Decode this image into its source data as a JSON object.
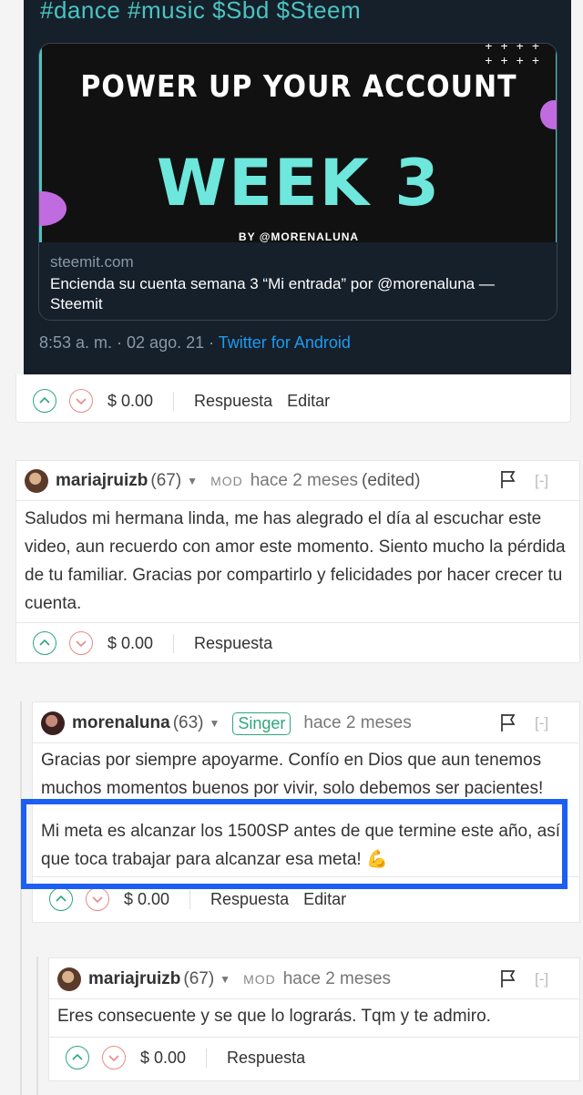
{
  "tweet": {
    "tags": "#dance #music $Sbd $Steem",
    "card_headline": "POWER UP YOUR ACCOUNT",
    "card_week": "WEEK 3",
    "card_by": "BY @MORENALUNA",
    "card_domain": "steemit.com",
    "card_title": "Encienda su cuenta semana 3 “Mi entrada” por @morenaluna — Steemit",
    "meta_time": "8:53 a. m. · 02 ago. 21 · ",
    "meta_source": "Twitter for Android"
  },
  "post_actions": {
    "amount": "$ 0.00",
    "reply": "Respuesta",
    "edit": "Editar"
  },
  "comments": [
    {
      "author": "mariajruizb",
      "rep": "(67)",
      "mod": "MOD",
      "time": "hace 2 meses",
      "edited": "(edited)",
      "collapse": "[-]",
      "body": "Saludos mi hermana linda, me has alegrado el día al escuchar este video, aun recuerdo con amor este momento. Siento mucho la pérdida de tu familiar. Gracias por compartirlo y felicidades por hacer crecer tu cuenta.",
      "amount": "$ 0.00",
      "reply": "Respuesta"
    },
    {
      "author": "morenaluna",
      "rep": "(63)",
      "badge": "Singer",
      "time": "hace 2 meses",
      "collapse": "[-]",
      "body_p1": "Gracias por siempre apoyarme. Confío en Dios que aun tenemos muchos momentos buenos por vivir, solo debemos ser pacientes!",
      "body_p2": "Mi meta es alcanzar los 1500SP antes de que termine este año, así que toca trabajar para alcanzar esa meta! 💪",
      "amount": "$ 0.00",
      "reply": "Respuesta",
      "edit": "Editar"
    },
    {
      "author": "mariajruizb",
      "rep": "(67)",
      "mod": "MOD",
      "time": "hace 2 meses",
      "collapse": "[-]",
      "body": "Eres consecuente y se que lo lograrás. Tqm y te admiro.",
      "amount": "$ 0.00",
      "reply": "Respuesta"
    }
  ],
  "colors": {
    "upvote": "#2ea77b",
    "downvote": "#e88a86",
    "highlight": "#1c5ff2",
    "tweet_bg": "#15202b"
  }
}
